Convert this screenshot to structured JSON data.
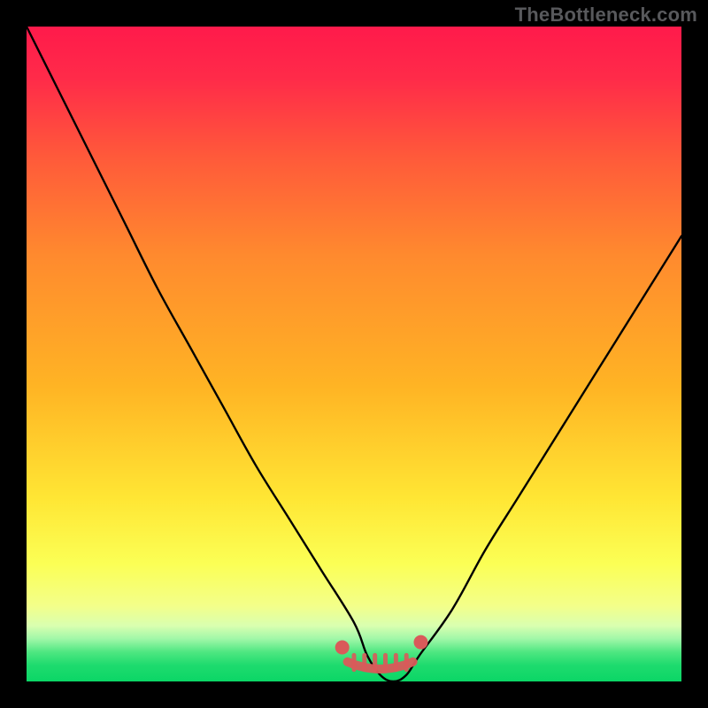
{
  "watermark": "TheBottleneck.com",
  "chart_data": {
    "type": "line",
    "title": "",
    "xlabel": "",
    "ylabel": "",
    "xlim": [
      0,
      100
    ],
    "ylim": [
      0,
      100
    ],
    "x": [
      0,
      5,
      10,
      15,
      20,
      25,
      30,
      35,
      40,
      45,
      50,
      52,
      54,
      56,
      58,
      60,
      65,
      70,
      75,
      80,
      85,
      90,
      95,
      100
    ],
    "values": [
      100,
      90,
      80,
      70,
      60,
      51,
      42,
      33,
      25,
      17,
      9,
      4,
      1,
      0,
      1,
      4,
      11,
      20,
      28,
      36,
      44,
      52,
      60,
      68
    ],
    "highlight_range_x": [
      47,
      61
    ],
    "highlight_value": 2,
    "gradient_stops": [
      {
        "offset": 0.0,
        "color": "#ff1a4b"
      },
      {
        "offset": 0.08,
        "color": "#ff2b49"
      },
      {
        "offset": 0.2,
        "color": "#ff5a3a"
      },
      {
        "offset": 0.35,
        "color": "#ff8a2e"
      },
      {
        "offset": 0.55,
        "color": "#ffb424"
      },
      {
        "offset": 0.72,
        "color": "#ffe634"
      },
      {
        "offset": 0.82,
        "color": "#fbff55"
      },
      {
        "offset": 0.885,
        "color": "#f3ff8a"
      },
      {
        "offset": 0.915,
        "color": "#d9ffb0"
      },
      {
        "offset": 0.935,
        "color": "#a0f7a8"
      },
      {
        "offset": 0.955,
        "color": "#4fe781"
      },
      {
        "offset": 0.975,
        "color": "#1edb6e"
      },
      {
        "offset": 1.0,
        "color": "#0bd666"
      }
    ],
    "curve_color": "#000000",
    "highlight_color": "#d95a5a",
    "frame_color": "#000000"
  }
}
